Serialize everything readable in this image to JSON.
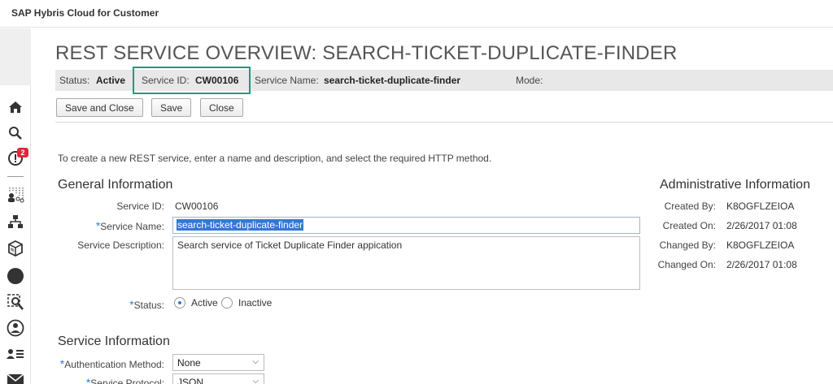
{
  "app": {
    "title": "SAP Hybris Cloud for Customer"
  },
  "sidebar": {
    "icons": [
      "home-icon",
      "search-icon",
      "notifications-icon",
      "org-chart-icon",
      "hierarchy-icon",
      "package-icon",
      "circle-icon",
      "analysis-icon",
      "person-icon",
      "user-list-icon",
      "mail-icon"
    ],
    "notification_count": "2"
  },
  "page": {
    "title": "REST SERVICE OVERVIEW: SEARCH-TICKET-DUPLICATE-FINDER"
  },
  "status_bar": {
    "status_label": "Status:",
    "status_value": "Active",
    "service_id_label": "Service ID:",
    "service_id_value": "CW00106",
    "service_name_label": "Service Name:",
    "service_name_value": "search-ticket-duplicate-finder",
    "mode_label": "Mode:",
    "mode_value": ""
  },
  "toolbar": {
    "save_close_label": "Save and Close",
    "save_label": "Save",
    "close_label": "Close"
  },
  "intro_text": "To create a new REST service, enter a name and description, and select the required HTTP method.",
  "general": {
    "heading": "General Information",
    "service_id_label": "Service ID:",
    "service_id_value": "CW00106",
    "service_name_label": "Service Name:",
    "service_name_value": "search-ticket-duplicate-finder",
    "description_label": "Service Description:",
    "description_value": "Search service of Ticket Duplicate Finder appication",
    "status_label": "Status:",
    "status_active": "Active",
    "status_inactive": "Inactive",
    "required_marker": "*"
  },
  "admin": {
    "heading": "Administrative Information",
    "created_by_label": "Created By:",
    "created_by_value": "K8OGFLZEIOA",
    "created_on_label": "Created On:",
    "created_on_value": "2/26/2017 01:08",
    "changed_by_label": "Changed By:",
    "changed_by_value": "K8OGFLZEIOA",
    "changed_on_label": "Changed On:",
    "changed_on_value": "2/26/2017 01:08"
  },
  "service_info": {
    "heading": "Service Information",
    "auth_method_label": "Authentication Method:",
    "auth_method_value": "None",
    "protocol_label": "Service Protocol:",
    "protocol_value": "JSON"
  },
  "colors": {
    "highlight_border": "#1f9b7e",
    "required_marker": "#2a7fd4",
    "badge": "#e0283a"
  }
}
